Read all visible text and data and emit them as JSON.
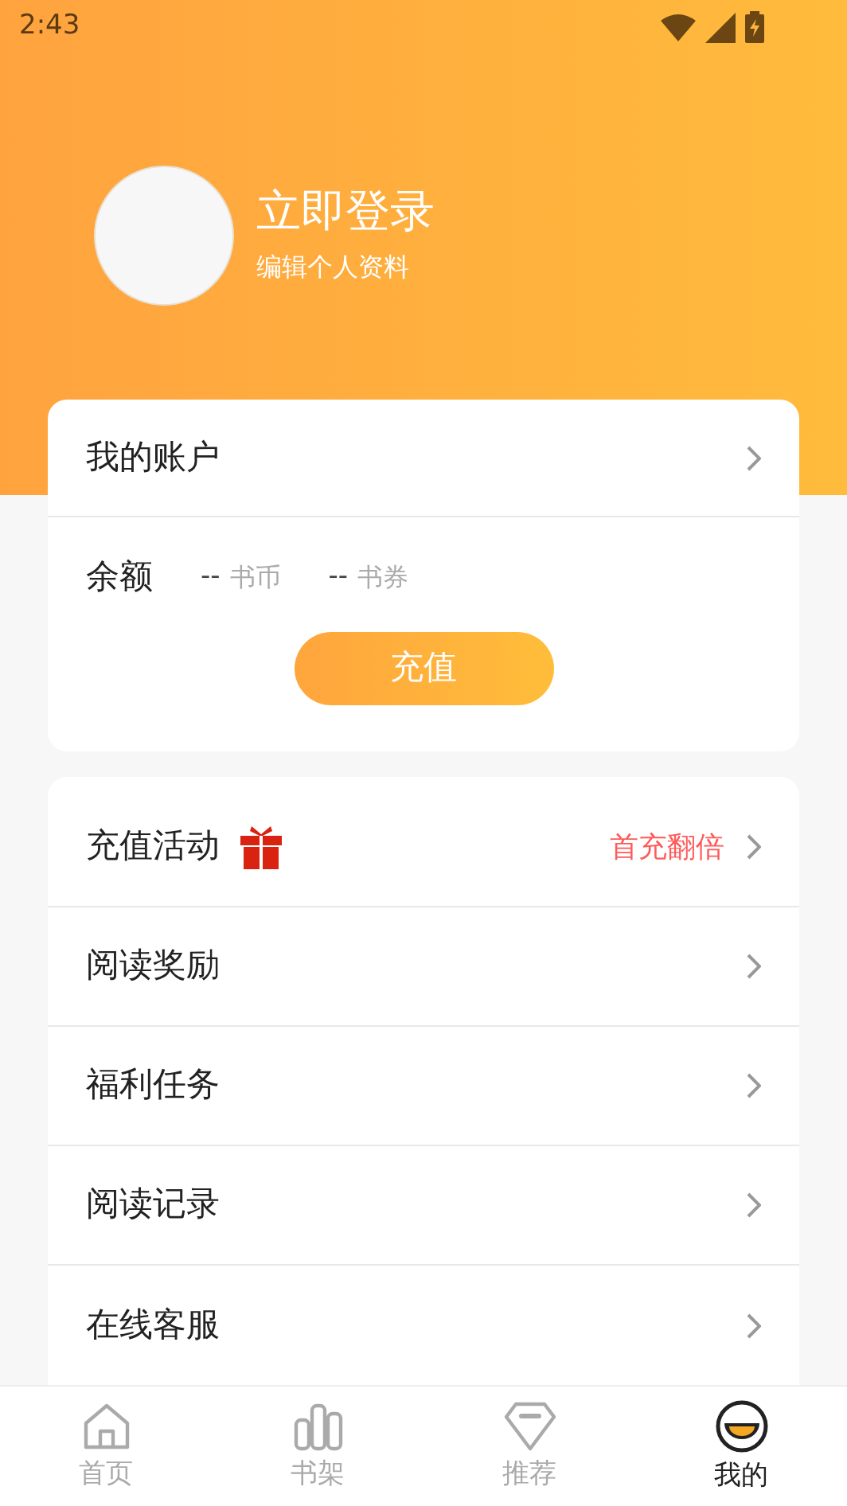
{
  "status_bar": {
    "time": "2:43"
  },
  "profile": {
    "title": "立即登录",
    "subtitle": "编辑个人资料"
  },
  "account": {
    "title": "我的账户",
    "balance_label": "余额",
    "balances": [
      {
        "value": "--",
        "unit": "书币"
      },
      {
        "value": "--",
        "unit": "书券"
      }
    ],
    "recharge_button": "充值"
  },
  "menu": [
    {
      "kind": "gift",
      "label": "充值活动",
      "note": "首充翻倍"
    },
    {
      "kind": "plain",
      "label": "阅读奖励"
    },
    {
      "kind": "plain",
      "label": "福利任务"
    },
    {
      "kind": "plain",
      "label": "阅读记录"
    },
    {
      "kind": "plain",
      "label": "在线客服"
    }
  ],
  "tabs": [
    {
      "label": "首页",
      "selected": false
    },
    {
      "label": "书架",
      "selected": false
    },
    {
      "label": "推荐",
      "selected": false
    },
    {
      "label": "我的",
      "selected": true
    }
  ]
}
